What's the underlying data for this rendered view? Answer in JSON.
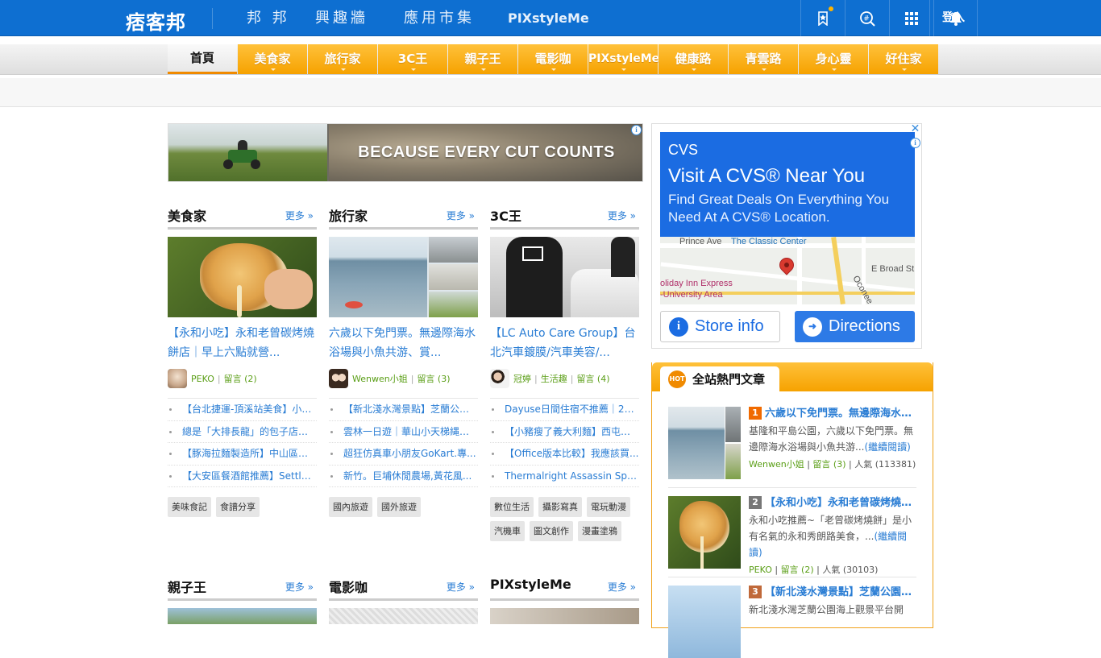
{
  "header": {
    "logo": "痞客邦",
    "nav": [
      "邦 邦",
      "興趣牆",
      "應用市集",
      "PIXstyleMe"
    ],
    "icons": [
      "bookmark-icon",
      "search-icon",
      "apps-grid-icon",
      "bell-icon"
    ],
    "login": "登入"
  },
  "categories": [
    "首頁",
    "美食家",
    "旅行家",
    "3C王",
    "親子王",
    "電影咖",
    "PIXstyleMe",
    "健康路",
    "青雲路",
    "身心靈",
    "好住家"
  ],
  "banner": {
    "text": "BECAUSE EVERY CUT COUNTS"
  },
  "sections": [
    {
      "title": "美食家",
      "more": "更多 »",
      "feature_title": "【永和小吃】永和老曾碳烤燒餅店｜早上六點就營...",
      "author": "PEKO",
      "comments": "留言 (2)",
      "list": [
        "【台北捷運-頂溪站美食】小籠湯包...",
        "總是「大排長龍」的包子店！...",
        "【豚海拉麵製造所】中山區拉麵...",
        "【大安區餐酒館推薦】Settle ..."
      ],
      "tags": [
        "美味食記",
        "食譜分享"
      ]
    },
    {
      "title": "旅行家",
      "more": "更多 »",
      "feature_title": "六歲以下免門票。無邊際海水浴場與小魚共游、賞...",
      "author": "Wenwen小姐",
      "comments": "留言 (3)",
      "list": [
        "【新北淺水灣景點】芝蘭公園海上...",
        "雲林一日遊｜華山小天梯縄索...",
        "超狂仿真車小朋友GoKart.專...",
        "新竹。巨埔休閒農場,黃花風..."
      ],
      "tags": [
        "國內旅遊",
        "國外旅遊"
      ]
    },
    {
      "title": "3C王",
      "more": "更多 »",
      "feature_title": "【LC Auto Care Group】台北汽車鍍膜/汽車美容/...",
      "author": "冠婷",
      "sub": "生活趣",
      "comments": "留言 (4)",
      "list": [
        "Dayuse日間住宿不推薦｜2023...",
        "【小豬瘦了義大利麵】西屯聚...",
        "【Office版本比較】我應該買...",
        "Thermalright Assassin Spirit ..."
      ],
      "tags": [
        "數位生活",
        "攝影寫真",
        "電玩動漫",
        "汽機車",
        "圖文創作",
        "漫畫塗鴉"
      ]
    }
  ],
  "bottom_sections": [
    {
      "title": "親子王",
      "more": "更多 »"
    },
    {
      "title": "電影咖",
      "more": "更多 »"
    },
    {
      "title": "PIXstyleMe",
      "more": "更多 »"
    }
  ],
  "side_ad": {
    "brand": "CVS",
    "headline": "Visit A CVS® Near You",
    "sub": "Find Great Deals On Everything You Need At A CVS® Location.",
    "map_labels": [
      "Prince Ave",
      "The Classic Center",
      "E Broad St",
      "oliday Inn Express",
      "-University Area",
      "Oconee"
    ],
    "store_button": "Store info",
    "directions_button": "Directions"
  },
  "hot": {
    "title": "全站熱門文章",
    "badge": "HOT",
    "items": [
      {
        "rank": "1",
        "rank_color": "#f06a00",
        "title": "六歲以下免門票。無邊際海水浴場與小魚共游",
        "desc": "基隆和平島公園，六歲以下免門票。無邊際海水浴場與小魚共游...",
        "read": "(繼續閱讀)",
        "author": "Wenwen小姐",
        "comments": "留言 (3)",
        "views": "人氣 (113381)"
      },
      {
        "rank": "2",
        "rank_color": "#777777",
        "title": "【永和小吃】永和老曾碳烤燒餅店",
        "desc": "永和小吃推薦~「老曾碳烤燒餅」是小有名氣的永和秀朗路美食，...",
        "read": "(繼續閱讀)",
        "author": "PEKO",
        "comments": "留言 (2)",
        "views": "人氣 (30103)"
      },
      {
        "rank": "3",
        "rank_color": "#c0693a",
        "title": "【新北淺水灣景點】芝蘭公園海上觀景平台",
        "desc": "新北淺水灣芝蘭公園海上觀景平台開",
        "read": "",
        "author": "",
        "comments": "",
        "views": ""
      }
    ]
  }
}
